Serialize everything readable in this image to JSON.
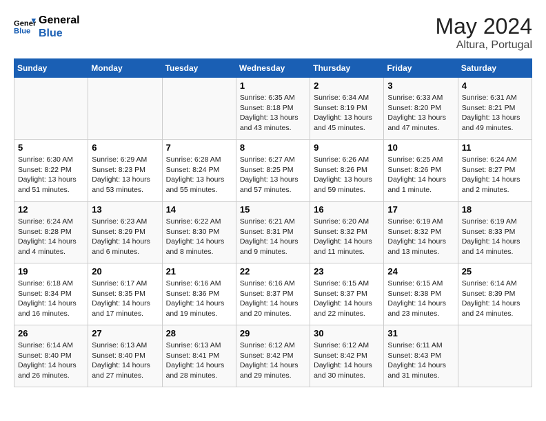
{
  "header": {
    "logo_general": "General",
    "logo_blue": "Blue",
    "month_year": "May 2024",
    "location": "Altura, Portugal"
  },
  "days_of_week": [
    "Sunday",
    "Monday",
    "Tuesday",
    "Wednesday",
    "Thursday",
    "Friday",
    "Saturday"
  ],
  "weeks": [
    [
      {
        "day": "",
        "info": ""
      },
      {
        "day": "",
        "info": ""
      },
      {
        "day": "",
        "info": ""
      },
      {
        "day": "1",
        "info": "Sunrise: 6:35 AM\nSunset: 8:18 PM\nDaylight: 13 hours and 43 minutes."
      },
      {
        "day": "2",
        "info": "Sunrise: 6:34 AM\nSunset: 8:19 PM\nDaylight: 13 hours and 45 minutes."
      },
      {
        "day": "3",
        "info": "Sunrise: 6:33 AM\nSunset: 8:20 PM\nDaylight: 13 hours and 47 minutes."
      },
      {
        "day": "4",
        "info": "Sunrise: 6:31 AM\nSunset: 8:21 PM\nDaylight: 13 hours and 49 minutes."
      }
    ],
    [
      {
        "day": "5",
        "info": "Sunrise: 6:30 AM\nSunset: 8:22 PM\nDaylight: 13 hours and 51 minutes."
      },
      {
        "day": "6",
        "info": "Sunrise: 6:29 AM\nSunset: 8:23 PM\nDaylight: 13 hours and 53 minutes."
      },
      {
        "day": "7",
        "info": "Sunrise: 6:28 AM\nSunset: 8:24 PM\nDaylight: 13 hours and 55 minutes."
      },
      {
        "day": "8",
        "info": "Sunrise: 6:27 AM\nSunset: 8:25 PM\nDaylight: 13 hours and 57 minutes."
      },
      {
        "day": "9",
        "info": "Sunrise: 6:26 AM\nSunset: 8:26 PM\nDaylight: 13 hours and 59 minutes."
      },
      {
        "day": "10",
        "info": "Sunrise: 6:25 AM\nSunset: 8:26 PM\nDaylight: 14 hours and 1 minute."
      },
      {
        "day": "11",
        "info": "Sunrise: 6:24 AM\nSunset: 8:27 PM\nDaylight: 14 hours and 2 minutes."
      }
    ],
    [
      {
        "day": "12",
        "info": "Sunrise: 6:24 AM\nSunset: 8:28 PM\nDaylight: 14 hours and 4 minutes."
      },
      {
        "day": "13",
        "info": "Sunrise: 6:23 AM\nSunset: 8:29 PM\nDaylight: 14 hours and 6 minutes."
      },
      {
        "day": "14",
        "info": "Sunrise: 6:22 AM\nSunset: 8:30 PM\nDaylight: 14 hours and 8 minutes."
      },
      {
        "day": "15",
        "info": "Sunrise: 6:21 AM\nSunset: 8:31 PM\nDaylight: 14 hours and 9 minutes."
      },
      {
        "day": "16",
        "info": "Sunrise: 6:20 AM\nSunset: 8:32 PM\nDaylight: 14 hours and 11 minutes."
      },
      {
        "day": "17",
        "info": "Sunrise: 6:19 AM\nSunset: 8:32 PM\nDaylight: 14 hours and 13 minutes."
      },
      {
        "day": "18",
        "info": "Sunrise: 6:19 AM\nSunset: 8:33 PM\nDaylight: 14 hours and 14 minutes."
      }
    ],
    [
      {
        "day": "19",
        "info": "Sunrise: 6:18 AM\nSunset: 8:34 PM\nDaylight: 14 hours and 16 minutes."
      },
      {
        "day": "20",
        "info": "Sunrise: 6:17 AM\nSunset: 8:35 PM\nDaylight: 14 hours and 17 minutes."
      },
      {
        "day": "21",
        "info": "Sunrise: 6:16 AM\nSunset: 8:36 PM\nDaylight: 14 hours and 19 minutes."
      },
      {
        "day": "22",
        "info": "Sunrise: 6:16 AM\nSunset: 8:37 PM\nDaylight: 14 hours and 20 minutes."
      },
      {
        "day": "23",
        "info": "Sunrise: 6:15 AM\nSunset: 8:37 PM\nDaylight: 14 hours and 22 minutes."
      },
      {
        "day": "24",
        "info": "Sunrise: 6:15 AM\nSunset: 8:38 PM\nDaylight: 14 hours and 23 minutes."
      },
      {
        "day": "25",
        "info": "Sunrise: 6:14 AM\nSunset: 8:39 PM\nDaylight: 14 hours and 24 minutes."
      }
    ],
    [
      {
        "day": "26",
        "info": "Sunrise: 6:14 AM\nSunset: 8:40 PM\nDaylight: 14 hours and 26 minutes."
      },
      {
        "day": "27",
        "info": "Sunrise: 6:13 AM\nSunset: 8:40 PM\nDaylight: 14 hours and 27 minutes."
      },
      {
        "day": "28",
        "info": "Sunrise: 6:13 AM\nSunset: 8:41 PM\nDaylight: 14 hours and 28 minutes."
      },
      {
        "day": "29",
        "info": "Sunrise: 6:12 AM\nSunset: 8:42 PM\nDaylight: 14 hours and 29 minutes."
      },
      {
        "day": "30",
        "info": "Sunrise: 6:12 AM\nSunset: 8:42 PM\nDaylight: 14 hours and 30 minutes."
      },
      {
        "day": "31",
        "info": "Sunrise: 6:11 AM\nSunset: 8:43 PM\nDaylight: 14 hours and 31 minutes."
      },
      {
        "day": "",
        "info": ""
      }
    ]
  ]
}
